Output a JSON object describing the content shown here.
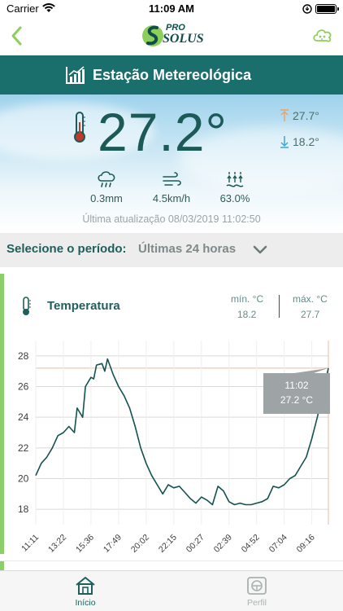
{
  "status_bar": {
    "carrier": "Carrier",
    "time": "11:09 AM"
  },
  "nav": {
    "logo_pro": "PRO",
    "logo_solus": "SOLUS"
  },
  "station": {
    "title": "Estação Metereológica"
  },
  "current": {
    "temperature": "27.2°",
    "max": "27.7°",
    "min": "18.2°",
    "rain": "0.3mm",
    "wind": "4.5km/h",
    "humidity": "63.0%",
    "updated": "Última atualização 08/03/2019 11:02:50"
  },
  "period": {
    "label": "Selecione o período:",
    "value": "Últimas 24 horas"
  },
  "temperature_card": {
    "title": "Temperatura",
    "min_label": "mín. °C",
    "min_value": "18.2",
    "max_label": "máx. °C",
    "max_value": "27.7",
    "tooltip_time": "11:02",
    "tooltip_value": "27.2 °C"
  },
  "chart_data": {
    "type": "line",
    "ylim": [
      17,
      29
    ],
    "yticks": [
      18,
      20,
      22,
      24,
      26,
      28
    ],
    "xticks": [
      "11:11",
      "13:22",
      "15:36",
      "17:49",
      "20:02",
      "22:15",
      "00:27",
      "02:39",
      "04:52",
      "07:04",
      "09:16"
    ],
    "reference_line": 27.2,
    "series": [
      {
        "color": "#14524f",
        "x": [
          0,
          0.2,
          0.4,
          0.6,
          0.8,
          1.0,
          1.2,
          1.4,
          1.5,
          1.7,
          1.8,
          2.0,
          2.1,
          2.2,
          2.4,
          2.5,
          2.6,
          2.8,
          3.0,
          3.2,
          3.4,
          3.6,
          3.8,
          4.0,
          4.2,
          4.4,
          4.6,
          4.8,
          5.0,
          5.2,
          5.4,
          5.6,
          5.8,
          6.0,
          6.2,
          6.4,
          6.6,
          6.8,
          7.0,
          7.2,
          7.4,
          7.6,
          7.8,
          8.0,
          8.2,
          8.4,
          8.6,
          8.8,
          9.0,
          9.2,
          9.4,
          9.6,
          9.8,
          10.0,
          10.2,
          10.4,
          10.6
        ],
        "values": [
          20.2,
          21.0,
          21.4,
          22.0,
          22.8,
          23.0,
          23.4,
          23.0,
          24.6,
          24.0,
          26.0,
          26.6,
          26.5,
          27.4,
          27.5,
          27.0,
          27.8,
          26.8,
          26.0,
          25.4,
          24.6,
          23.4,
          22.0,
          21.0,
          20.2,
          19.6,
          19.0,
          19.6,
          19.4,
          19.5,
          19.1,
          18.7,
          18.4,
          18.8,
          18.6,
          18.3,
          19.5,
          19.2,
          18.5,
          18.3,
          18.4,
          18.3,
          18.3,
          18.4,
          18.5,
          18.7,
          19.5,
          19.4,
          19.6,
          20.0,
          20.2,
          20.8,
          21.4,
          22.6,
          24.0,
          25.6,
          27.2
        ]
      }
    ]
  },
  "tabs": [
    {
      "label": "Início",
      "icon": "home-icon"
    },
    {
      "label": "Perfil",
      "icon": "profile-icon"
    }
  ]
}
